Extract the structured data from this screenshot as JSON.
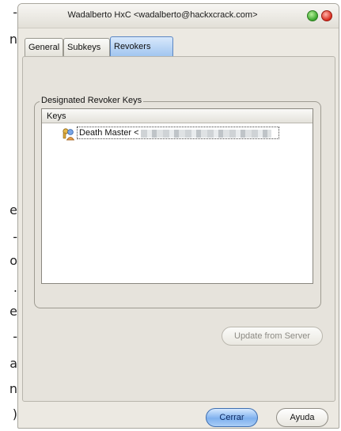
{
  "background_text": [
    "-",
    "n",
    "e",
    "-",
    "o",
    ".",
    "e",
    "-",
    "a",
    "n",
    ")"
  ],
  "window": {
    "title": "Wadalberto HxC <wadalberto@hackxcrack.com>"
  },
  "tabs": [
    {
      "label": "General",
      "selected": false
    },
    {
      "label": "Subkeys",
      "selected": false
    },
    {
      "label": "Revokers",
      "selected": true
    }
  ],
  "revokers": {
    "group_label": "Designated Revoker Keys",
    "list_header": "Keys",
    "rows": [
      {
        "name": "Death Master <",
        "suffix": ">",
        "icon": "key-pair-icon"
      }
    ],
    "update_button": "Update from Server",
    "update_button_enabled": false
  },
  "footer": {
    "close_label": "Cerrar",
    "help_label": "Ayuda"
  },
  "colors": {
    "accent": "#7fb1ee",
    "window_bg": "#ece9e2"
  }
}
